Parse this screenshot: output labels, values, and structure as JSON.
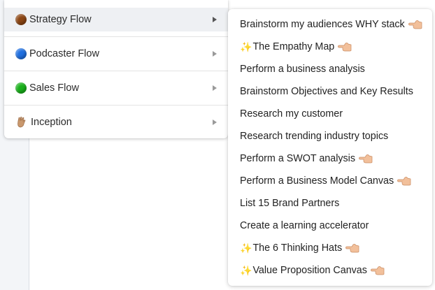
{
  "main_menu": {
    "items": [
      {
        "label": "Strategy Flow",
        "icon": "brown-circle-icon",
        "color": "#8b4513"
      },
      {
        "label": "Podcaster Flow",
        "icon": "blue-circle-icon",
        "color": "#1f6fe0"
      },
      {
        "label": "Sales Flow",
        "icon": "green-circle-icon",
        "color": "#19b01a"
      },
      {
        "label": "Inception",
        "icon": "vulcan-salute-icon"
      }
    ]
  },
  "sub_menu": {
    "items": [
      {
        "label": "Brainstorm my audiences WHY stack",
        "sparkle": false,
        "pointer": true
      },
      {
        "label": "The Empathy Map",
        "sparkle": true,
        "pointer": true
      },
      {
        "label": "Perform a business analysis",
        "sparkle": false,
        "pointer": false
      },
      {
        "label": "Brainstorm Objectives and Key Results",
        "sparkle": false,
        "pointer": false
      },
      {
        "label": "Research my customer",
        "sparkle": false,
        "pointer": false
      },
      {
        "label": "Research trending industry topics",
        "sparkle": false,
        "pointer": false
      },
      {
        "label": "Perform a SWOT analysis",
        "sparkle": false,
        "pointer": true
      },
      {
        "label": "Perform a Business Model Canvas",
        "sparkle": false,
        "pointer": true
      },
      {
        "label": "List 15 Brand Partners",
        "sparkle": false,
        "pointer": false
      },
      {
        "label": "Create a learning accelerator",
        "sparkle": false,
        "pointer": false
      },
      {
        "label": "The 6 Thinking Hats",
        "sparkle": true,
        "pointer": true
      },
      {
        "label": "Value Proposition Canvas",
        "sparkle": true,
        "pointer": true
      }
    ]
  },
  "glyphs": {
    "sparkle": "✨"
  }
}
